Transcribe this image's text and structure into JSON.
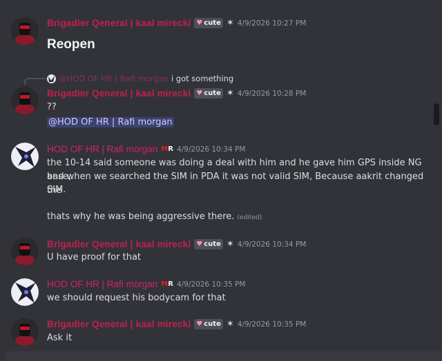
{
  "messages": [
    {
      "author": "Brigadier Qeneral | kaal mirecki",
      "tag": "cute",
      "time": "4/9/2026 10:27 PM",
      "lines": [
        "Reopen"
      ]
    },
    {
      "reply": {
        "name": "@HOD OF HR | Rafi morgan",
        "text": "i got something"
      },
      "author": "Brigadier Qeneral | kaal mirecki",
      "tag": "cute",
      "time": "4/9/2026 10:28 PM",
      "lines": [
        "??"
      ],
      "mention": "@HOD OF HR | Rafi morgan"
    },
    {
      "author": "HOD OF HR | Rafi morgan",
      "badge": "MR",
      "time": "4/9/2026 10:34 PM",
      "lines": [
        "the 10-14 said someone was doing a deal with him and he gave him GPS inside NG base,",
        "and when we searched the SIM in PDA it was not valid SIM, Because aakrit changed the",
        "SIM.",
        "thats why he was being aggressive there."
      ],
      "edited": "(edited)"
    },
    {
      "author": "Brigadier Qeneral | kaal mirecki",
      "tag": "cute",
      "time": "4/9/2026 10:34 PM",
      "lines": [
        "U have proof for that"
      ]
    },
    {
      "author": "HOD OF HR | Rafi morgan",
      "badge": "MR",
      "time": "4/9/2026 10:35 PM",
      "lines": [
        "we should request his bodycam for that"
      ]
    },
    {
      "author": "Brigadier Qeneral | kaal mirecki",
      "tag": "cute",
      "time": "4/9/2026 10:35 PM",
      "lines": [
        "Ask it"
      ]
    }
  ],
  "colors": {
    "brig": "#c41f4f",
    "hod": "#d4206d",
    "bg": "#313338"
  }
}
